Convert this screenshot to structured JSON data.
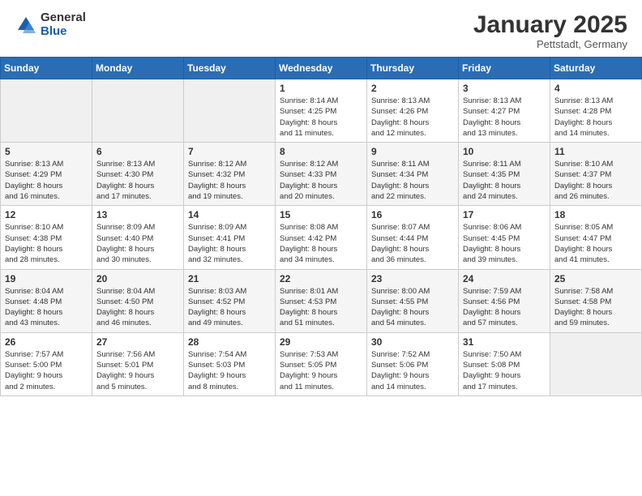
{
  "header": {
    "logo_general": "General",
    "logo_blue": "Blue",
    "title": "January 2025",
    "subtitle": "Pettstadt, Germany"
  },
  "weekdays": [
    "Sunday",
    "Monday",
    "Tuesday",
    "Wednesday",
    "Thursday",
    "Friday",
    "Saturday"
  ],
  "weeks": [
    [
      {
        "day": "",
        "info": ""
      },
      {
        "day": "",
        "info": ""
      },
      {
        "day": "",
        "info": ""
      },
      {
        "day": "1",
        "info": "Sunrise: 8:14 AM\nSunset: 4:25 PM\nDaylight: 8 hours\nand 11 minutes."
      },
      {
        "day": "2",
        "info": "Sunrise: 8:13 AM\nSunset: 4:26 PM\nDaylight: 8 hours\nand 12 minutes."
      },
      {
        "day": "3",
        "info": "Sunrise: 8:13 AM\nSunset: 4:27 PM\nDaylight: 8 hours\nand 13 minutes."
      },
      {
        "day": "4",
        "info": "Sunrise: 8:13 AM\nSunset: 4:28 PM\nDaylight: 8 hours\nand 14 minutes."
      }
    ],
    [
      {
        "day": "5",
        "info": "Sunrise: 8:13 AM\nSunset: 4:29 PM\nDaylight: 8 hours\nand 16 minutes."
      },
      {
        "day": "6",
        "info": "Sunrise: 8:13 AM\nSunset: 4:30 PM\nDaylight: 8 hours\nand 17 minutes."
      },
      {
        "day": "7",
        "info": "Sunrise: 8:12 AM\nSunset: 4:32 PM\nDaylight: 8 hours\nand 19 minutes."
      },
      {
        "day": "8",
        "info": "Sunrise: 8:12 AM\nSunset: 4:33 PM\nDaylight: 8 hours\nand 20 minutes."
      },
      {
        "day": "9",
        "info": "Sunrise: 8:11 AM\nSunset: 4:34 PM\nDaylight: 8 hours\nand 22 minutes."
      },
      {
        "day": "10",
        "info": "Sunrise: 8:11 AM\nSunset: 4:35 PM\nDaylight: 8 hours\nand 24 minutes."
      },
      {
        "day": "11",
        "info": "Sunrise: 8:10 AM\nSunset: 4:37 PM\nDaylight: 8 hours\nand 26 minutes."
      }
    ],
    [
      {
        "day": "12",
        "info": "Sunrise: 8:10 AM\nSunset: 4:38 PM\nDaylight: 8 hours\nand 28 minutes."
      },
      {
        "day": "13",
        "info": "Sunrise: 8:09 AM\nSunset: 4:40 PM\nDaylight: 8 hours\nand 30 minutes."
      },
      {
        "day": "14",
        "info": "Sunrise: 8:09 AM\nSunset: 4:41 PM\nDaylight: 8 hours\nand 32 minutes."
      },
      {
        "day": "15",
        "info": "Sunrise: 8:08 AM\nSunset: 4:42 PM\nDaylight: 8 hours\nand 34 minutes."
      },
      {
        "day": "16",
        "info": "Sunrise: 8:07 AM\nSunset: 4:44 PM\nDaylight: 8 hours\nand 36 minutes."
      },
      {
        "day": "17",
        "info": "Sunrise: 8:06 AM\nSunset: 4:45 PM\nDaylight: 8 hours\nand 39 minutes."
      },
      {
        "day": "18",
        "info": "Sunrise: 8:05 AM\nSunset: 4:47 PM\nDaylight: 8 hours\nand 41 minutes."
      }
    ],
    [
      {
        "day": "19",
        "info": "Sunrise: 8:04 AM\nSunset: 4:48 PM\nDaylight: 8 hours\nand 43 minutes."
      },
      {
        "day": "20",
        "info": "Sunrise: 8:04 AM\nSunset: 4:50 PM\nDaylight: 8 hours\nand 46 minutes."
      },
      {
        "day": "21",
        "info": "Sunrise: 8:03 AM\nSunset: 4:52 PM\nDaylight: 8 hours\nand 49 minutes."
      },
      {
        "day": "22",
        "info": "Sunrise: 8:01 AM\nSunset: 4:53 PM\nDaylight: 8 hours\nand 51 minutes."
      },
      {
        "day": "23",
        "info": "Sunrise: 8:00 AM\nSunset: 4:55 PM\nDaylight: 8 hours\nand 54 minutes."
      },
      {
        "day": "24",
        "info": "Sunrise: 7:59 AM\nSunset: 4:56 PM\nDaylight: 8 hours\nand 57 minutes."
      },
      {
        "day": "25",
        "info": "Sunrise: 7:58 AM\nSunset: 4:58 PM\nDaylight: 8 hours\nand 59 minutes."
      }
    ],
    [
      {
        "day": "26",
        "info": "Sunrise: 7:57 AM\nSunset: 5:00 PM\nDaylight: 9 hours\nand 2 minutes."
      },
      {
        "day": "27",
        "info": "Sunrise: 7:56 AM\nSunset: 5:01 PM\nDaylight: 9 hours\nand 5 minutes."
      },
      {
        "day": "28",
        "info": "Sunrise: 7:54 AM\nSunset: 5:03 PM\nDaylight: 9 hours\nand 8 minutes."
      },
      {
        "day": "29",
        "info": "Sunrise: 7:53 AM\nSunset: 5:05 PM\nDaylight: 9 hours\nand 11 minutes."
      },
      {
        "day": "30",
        "info": "Sunrise: 7:52 AM\nSunset: 5:06 PM\nDaylight: 9 hours\nand 14 minutes."
      },
      {
        "day": "31",
        "info": "Sunrise: 7:50 AM\nSunset: 5:08 PM\nDaylight: 9 hours\nand 17 minutes."
      },
      {
        "day": "",
        "info": ""
      }
    ]
  ]
}
